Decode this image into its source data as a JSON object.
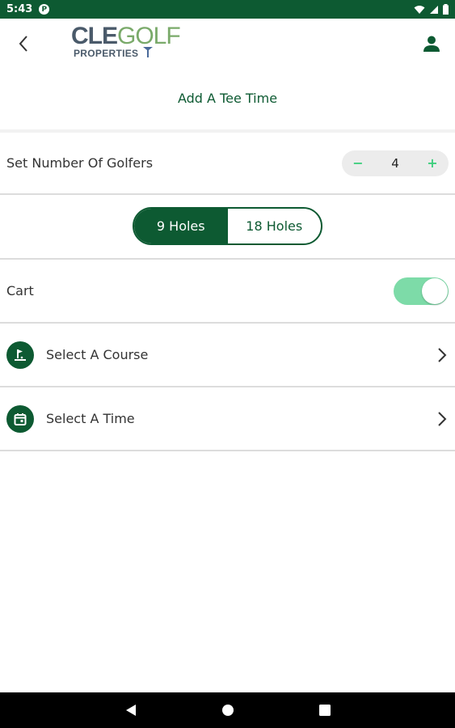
{
  "status_bar": {
    "time": "5:43",
    "app_icon_letter": "P"
  },
  "header": {
    "logo": {
      "main_left": "CLE",
      "main_right": "GOLF",
      "subtitle": "PROPERTIES"
    },
    "back_icon": "chevron-left-icon",
    "profile_icon": "person-icon"
  },
  "page": {
    "title": "Add A Tee Time"
  },
  "golfers": {
    "label": "Set Number Of Golfers",
    "minus": "−",
    "plus": "+",
    "value": "4"
  },
  "holes": {
    "options": [
      "9 Holes",
      "18 Holes"
    ],
    "selected": "9 Holes"
  },
  "cart": {
    "label": "Cart",
    "enabled": true
  },
  "nav_rows": [
    {
      "label": "Select A Course",
      "icon": "golf-flag-icon"
    },
    {
      "label": "Select A Time",
      "icon": "calendar-icon"
    }
  ],
  "colors": {
    "brand_green": "#0d5a32",
    "accent_green": "#3fcf7e",
    "toggle_track": "#7ddba8"
  }
}
